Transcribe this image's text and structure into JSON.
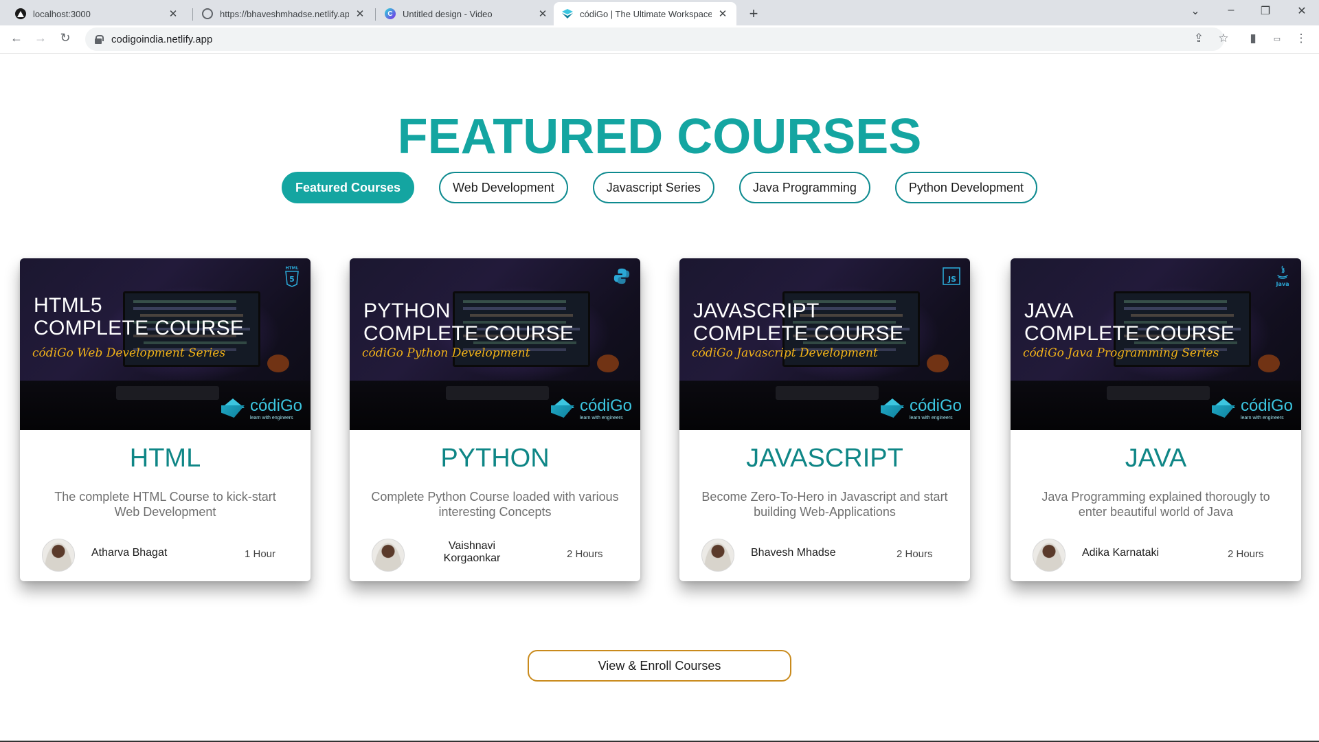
{
  "browser": {
    "tabs": [
      {
        "title": "localhost:3000",
        "icon": "vercel-icon",
        "active": false
      },
      {
        "title": "https://bhaveshmhadse.netlify.app",
        "icon": "globe-icon",
        "active": false
      },
      {
        "title": "Untitled design - Video",
        "icon": "canva-icon",
        "active": false
      },
      {
        "title": "códiGo | The Ultimate Workspace",
        "icon": "codigo-icon",
        "active": true
      }
    ],
    "url": "codigoindia.netlify.app"
  },
  "page": {
    "headline": "FEATURED COURSES",
    "filters": [
      {
        "label": "Featured Courses",
        "active": true
      },
      {
        "label": "Web Development",
        "active": false
      },
      {
        "label": "Javascript Series",
        "active": false
      },
      {
        "label": "Java Programming",
        "active": false
      },
      {
        "label": "Python Development",
        "active": false
      }
    ],
    "courses": [
      {
        "thumb_line1": "HTML5",
        "thumb_line2": "COMPLETE COURSE",
        "thumb_script": "códiGo Web Development Series",
        "tech_icon": "html5-icon",
        "title": "HTML",
        "description": "The complete HTML Course to kick-start Web Development",
        "author": "Atharva Bhagat",
        "duration": "1 Hour"
      },
      {
        "thumb_line1": "PYTHON",
        "thumb_line2": "COMPLETE COURSE",
        "thumb_script": "códiGo Python Development",
        "tech_icon": "python-icon",
        "title": "PYTHON",
        "description": "Complete Python Course loaded with various interesting Concepts",
        "author": "Vaishnavi Korgaonkar",
        "duration": "2 Hours"
      },
      {
        "thumb_line1": "JAVASCRIPT",
        "thumb_line2": "COMPLETE COURSE",
        "thumb_script": "códiGo Javascript Development",
        "tech_icon": "javascript-icon",
        "title": "JAVASCRIPT",
        "description": "Become Zero-To-Hero in Javascript and start building Web-Applications",
        "author": "Bhavesh Mhadse",
        "duration": "2 Hours"
      },
      {
        "thumb_line1": "JAVA",
        "thumb_line2": "COMPLETE COURSE",
        "thumb_script": "códiGo Java Programming Series",
        "tech_icon": "java-icon",
        "title": "JAVA",
        "description": "Java Programming explained thorougly to enter beautiful world of Java",
        "author": "Adika Karnataki",
        "duration": "2 Hours"
      }
    ],
    "brand_name": "códiGo",
    "brand_tagline": "learn with engineers",
    "enroll_label": "View & Enroll Courses",
    "colors": {
      "accent": "#14a5a1",
      "title": "#0f8686",
      "button_border": "#c98a1c"
    }
  }
}
